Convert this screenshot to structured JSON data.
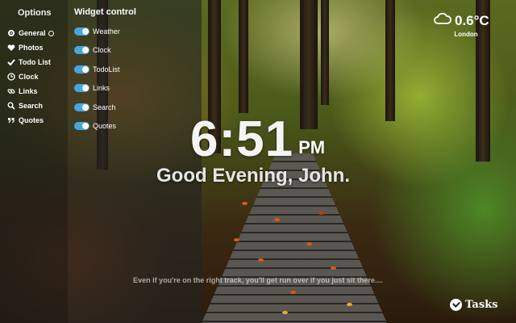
{
  "options": {
    "title": "Options",
    "items": [
      {
        "label": "General",
        "icon": "gear-icon"
      },
      {
        "label": "Photos",
        "icon": "heart-icon"
      },
      {
        "label": "Todo List",
        "icon": "check-icon"
      },
      {
        "label": "Clock",
        "icon": "clock-icon"
      },
      {
        "label": "Links",
        "icon": "link-icon"
      },
      {
        "label": "Search",
        "icon": "search-icon"
      },
      {
        "label": "Quotes",
        "icon": "quote-icon"
      }
    ]
  },
  "widget_control": {
    "title": "Widget control",
    "toggle_color": "#46a6e0",
    "items": [
      {
        "label": "Weather",
        "enabled": true
      },
      {
        "label": "Clock",
        "enabled": true
      },
      {
        "label": "TodoList",
        "enabled": true
      },
      {
        "label": "Links",
        "enabled": true
      },
      {
        "label": "Search",
        "enabled": true
      },
      {
        "label": "Quotes",
        "enabled": true
      }
    ]
  },
  "clock": {
    "time": "6:51",
    "ampm": "PM"
  },
  "greeting": "Good Evening, John.",
  "weather": {
    "icon": "cloud-icon",
    "temperature": "0.6°C",
    "location": "London"
  },
  "quote": "Even if you're on the right track, you'll get run over if you just sit there....",
  "tasks": {
    "label": "Tasks",
    "icon": "check-circle-icon"
  }
}
